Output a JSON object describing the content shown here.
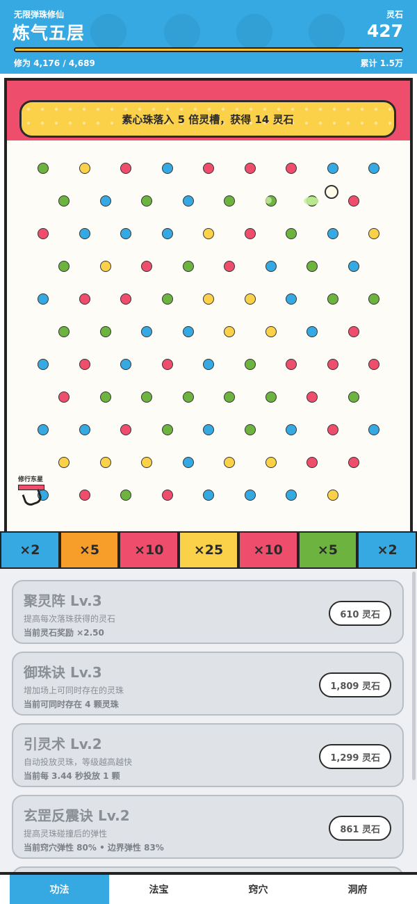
{
  "header": {
    "subtitle": "无限弹珠修仙",
    "realm": "炼气五层",
    "stone_label": "灵石",
    "stone_value": "427",
    "xp_text": "修为 4,176 / 4,689",
    "xp_fraction": 0.89,
    "total_text": "累计 1.5万"
  },
  "board": {
    "banner": "素心珠落入 5 倍灵槽，获得 14 灵石",
    "launcher_label": "修行东星",
    "peg_colors": {
      "G": "#6db33f",
      "Y": "#fcd14a",
      "R": "#ee4d6c",
      "B": "#36a9e3"
    },
    "peg_rows": [
      "GYRBRRRBB",
      "GBGBGGGR",
      "RBBBYRGBY",
      "GYRGRBGB",
      "BRRGYYBGG",
      "GGBBYYBR",
      "BRBRBGRRR",
      "RGGGGGRG",
      "BBRGBGBRB",
      "YYYBYYRR",
      "BRGRBBBY"
    ]
  },
  "slots": [
    {
      "label": "×2",
      "color": "#36a9e3"
    },
    {
      "label": "×5",
      "color": "#f79d2a"
    },
    {
      "label": "×10",
      "color": "#ee4d6c"
    },
    {
      "label": "×25",
      "color": "#fcd14a"
    },
    {
      "label": "×10",
      "color": "#ee4d6c"
    },
    {
      "label": "×5",
      "color": "#6db33f"
    },
    {
      "label": "×2",
      "color": "#36a9e3"
    }
  ],
  "upgrades": [
    {
      "title": "聚灵阵 Lv.3",
      "desc": "提高每次落珠获得的灵石",
      "current": "当前灵石奖励 ×2.50",
      "price": "610 灵石"
    },
    {
      "title": "御珠诀 Lv.3",
      "desc": "增加场上可同时存在的灵珠",
      "current": "当前可同时存在 4 颗灵珠",
      "price": "1,809 灵石"
    },
    {
      "title": "引灵术 Lv.2",
      "desc": "自动投放灵珠，等级越高越快",
      "current": "当前每 3.44 秒投放 1 颗",
      "price": "1,299 灵石"
    },
    {
      "title": "玄罡反震诀 Lv.2",
      "desc": "提高灵珠碰撞后的弹性",
      "current": "当前窍穴弹性 80% • 边界弹性 83%",
      "price": "861 灵石"
    }
  ],
  "tabs": [
    "功法",
    "法宝",
    "窍穴",
    "洞府"
  ],
  "active_tab": 0
}
